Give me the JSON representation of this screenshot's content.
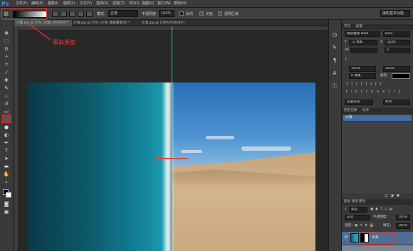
{
  "app": {
    "logo": "Ps"
  },
  "menubar": {
    "items": [
      "文件(F)",
      "编辑(E)",
      "图像(I)",
      "图层(L)",
      "文字(Y)",
      "选择(S)",
      "滤镜(T)",
      "3D(D)",
      "视图(V)",
      "窗口(W)",
      "帮助(H)"
    ]
  },
  "options": {
    "mode_label": "模式:",
    "mode_value": "正常",
    "opacity_label": "不透明度:",
    "opacity_value": "100%",
    "reverse_label": "反向",
    "dither_label": "仿色",
    "transparency_label": "透明区域",
    "workspace_value": "摄影基本功能"
  },
  "tabs": [
    {
      "label": "大图.jpg @ 25% (大图, RGB/8#) *",
      "active": true
    },
    {
      "label": "大海.jpg @ 25% (大海, 图层蒙版/8) *",
      "active": false
    },
    {
      "label": "沙漠.jpg @ 100%(RGB/8#)",
      "active": false
    }
  ],
  "annotation": {
    "text": "黑白渐变",
    "color": "#e02b2b"
  },
  "character_panel": {
    "tabs": [
      "字符",
      "段落"
    ],
    "font_family": "微软雅黑 Bold",
    "font_style": "Bold",
    "size": "72 像素",
    "leading": "(自动)",
    "kerning": "0",
    "scale_v": "100%",
    "scale_h": "100%",
    "baseline": "0 像素",
    "color_label": "颜色:",
    "antialias": "犀利",
    "language": "美国英语"
  },
  "history_panel": {
    "tabs": [
      "历史记录",
      "动作"
    ],
    "items": [
      "大海"
    ]
  },
  "layers_panel": {
    "kind": "类型",
    "blend": "正常",
    "opacity_label": "不透明度:",
    "opacity": "100%",
    "lock_label": "锁定:",
    "fill_label": "填充:",
    "fill": "100%",
    "layers": [
      {
        "name": "大海"
      }
    ]
  },
  "tools": [
    "move-icon",
    "marquee-icon",
    "lasso-icon",
    "magic-wand-icon",
    "crop-icon",
    "eyedropper-icon",
    "healing-icon",
    "brush-icon",
    "stamp-icon",
    "history-brush-icon",
    "eraser-icon",
    "gradient-icon",
    "blur-icon",
    "dodge-icon",
    "pen-icon",
    "type-icon",
    "path-select-icon",
    "shape-icon",
    "hand-icon",
    "zoom-icon"
  ],
  "colors": {
    "accent": "#2f90f5",
    "guide": "#2bd0d8",
    "annotation": "#e02b2b"
  }
}
